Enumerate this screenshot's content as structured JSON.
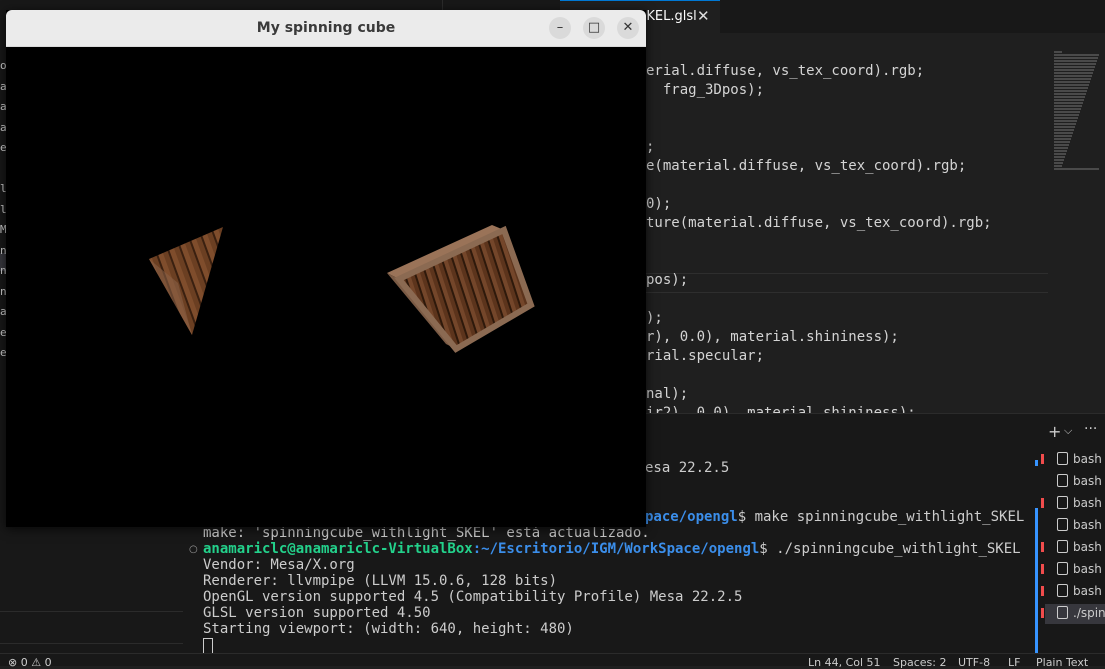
{
  "editor_tab": {
    "name": "...KEL.glsl",
    "close": "✕"
  },
  "sidebar_fragments": [
    "o",
    "a",
    "a",
    "a",
    "e.",
    "",
    "le",
    "le",
    "M",
    "ng",
    "ng",
    "ng",
    "a",
    "e_",
    "e."
  ],
  "code_lines": [
    "erial.diffuse, vs_tex_coord).rgb;",
    "  frag_3Dpos);",
    "",
    "",
    ";",
    "e(material.diffuse, vs_tex_coord).rgb;",
    "",
    "0);",
    "ture(material.diffuse, vs_tex_coord).rgb;",
    "",
    "",
    "pos);",
    "",
    ");",
    "r), 0.0), material.shininess);",
    "rial.specular;",
    "",
    "nal);",
    "ir2), 0.0), material.shininess);"
  ],
  "panel": {
    "add": "+",
    "chevron": "⌵",
    "more": "···"
  },
  "terminal": {
    "tail1": "esa 22.2.5",
    "tail2_path": "pace/opengl",
    "tail2_cmd": "$ make spinningcube_withlight_SKEL",
    "line_make": "make: 'spinningcube_withlight_SKEL' está actualizado.",
    "prompt_user": "anamariclc@anamariclc-VirtualBox",
    "prompt_path": ":~/Escritorio/IGM/WorkSpace/opengl",
    "prompt_cmd": "$ ./spinningcube_withlight_SKEL",
    "vendor": "Vendor: Mesa/X.org",
    "renderer": "Renderer: llvmpipe (LLVM 15.0.6, 128 bits)",
    "gl_version": "OpenGL version supported 4.5 (Compatibility Profile) Mesa 22.2.5",
    "glsl_version": "GLSL version supported 4.50",
    "viewport": "Starting viewport: (width: 640, height: 480)",
    "dot": "○"
  },
  "terminal_list": [
    "bash",
    "bash",
    "bash",
    "bash",
    "bash",
    "bash",
    "bash",
    "./spin"
  ],
  "statusbar": {
    "left": "⊗ 0 ⚠ 0",
    "position": "Ln 44, Col 51",
    "spaces": "Spaces: 2",
    "encoding": "UTF-8",
    "eol": "LF",
    "language": "Plain Text"
  },
  "window": {
    "title": "My spinning cube",
    "minimize": "–",
    "maximize": "□",
    "close": "✕"
  },
  "colors": {
    "accent": "#0078d4",
    "prompt_user": "#23d18b",
    "prompt_path": "#3b8eea",
    "crate": "#7a4a2a"
  }
}
